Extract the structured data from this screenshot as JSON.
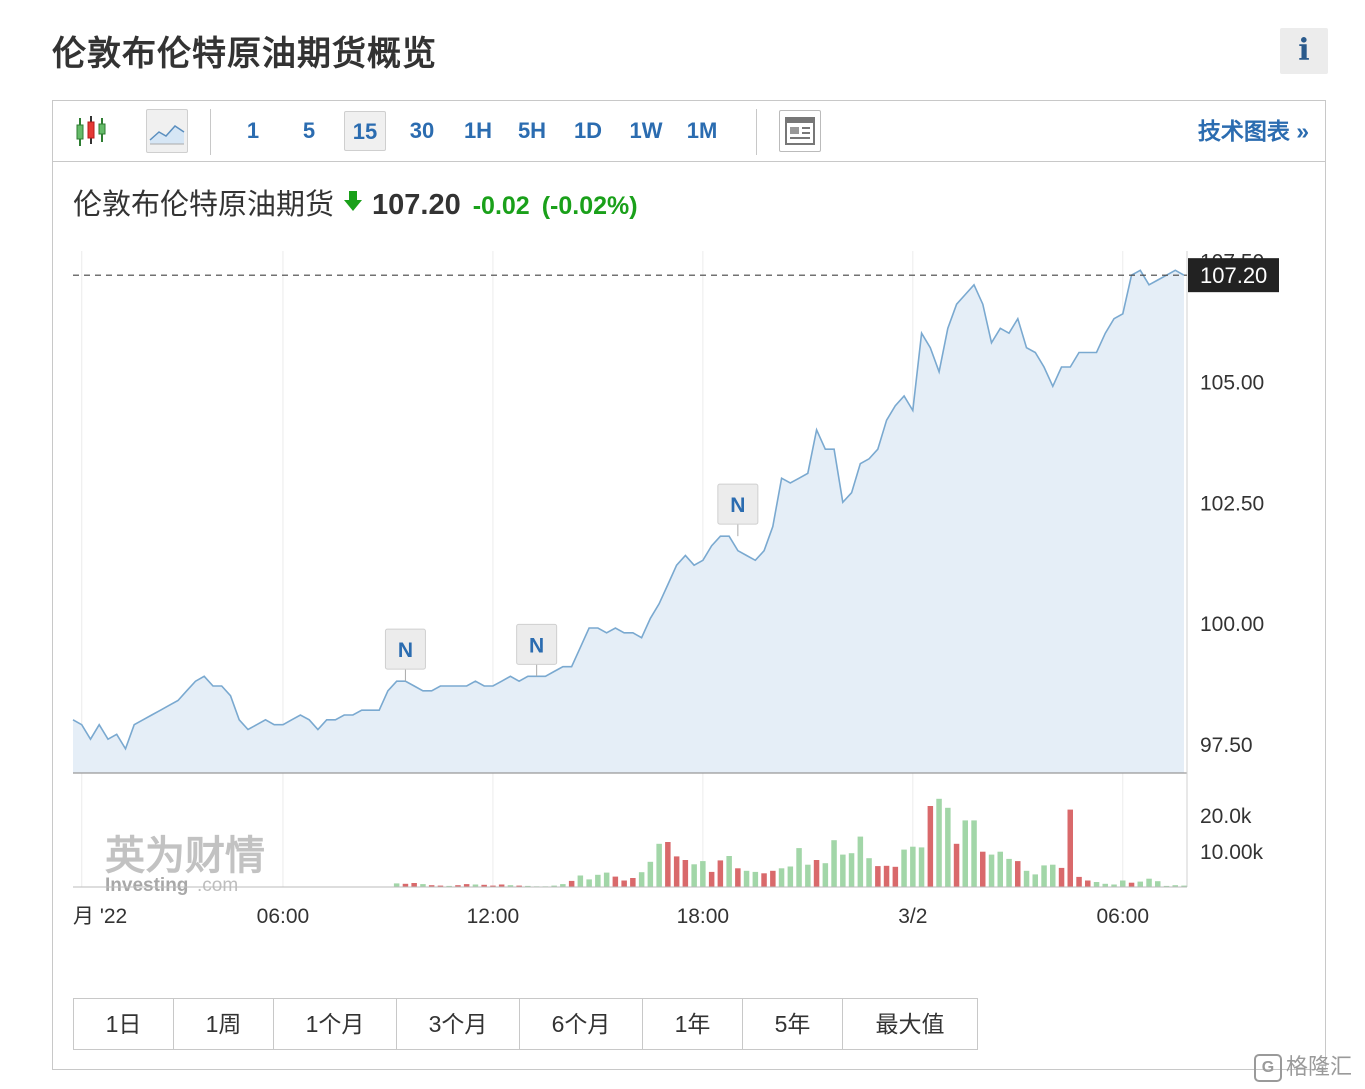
{
  "page": {
    "title": "伦敦布伦特原油期货概览",
    "info_label": "i"
  },
  "toolbar": {
    "intervals": [
      "1",
      "5",
      "15",
      "30",
      "1H",
      "5H",
      "1D",
      "1W",
      "1M"
    ],
    "active_interval": "15",
    "tech_chart_label": "技术图表 »"
  },
  "quote": {
    "name": "伦敦布伦特原油期货",
    "direction": "down",
    "price": "107.20",
    "change": "-0.02",
    "change_pct": "(-0.02%)",
    "change_color": "#1aa01a"
  },
  "watermark": {
    "cn": "英为财情",
    "en": "Investing",
    "suffix": ".com"
  },
  "range_buttons": [
    "1日",
    "1周",
    "1个月",
    "3个月",
    "6个月",
    "1年",
    "5年",
    "最大值"
  ],
  "corner_logo": {
    "text": "格隆汇"
  },
  "colors": {
    "line": "#7aa9d0",
    "area": "#e5eef7",
    "vol_up": "#a2d6a8",
    "vol_down": "#d9696b",
    "accent": "#2b6cb0",
    "price_tag_bg": "#222222"
  },
  "chart_data": [
    {
      "type": "area",
      "title": "",
      "ylabel": "",
      "ylim": [
        96.9,
        107.7
      ],
      "y_tick_labels": [
        "107.50",
        "105.00",
        "102.50",
        "100.00",
        "97.50"
      ],
      "x_tick_labels": [
        {
          "label": "月 '22",
          "t": 1
        },
        {
          "label": "06:00",
          "t": 24
        },
        {
          "label": "12:00",
          "t": 48
        },
        {
          "label": "18:00",
          "t": 72
        },
        {
          "label": "3/2",
          "t": 96
        },
        {
          "label": "06:00",
          "t": 120
        }
      ],
      "current_price": {
        "value": 107.2,
        "label": "107.20"
      },
      "series": [
        {
          "values": [
            98.0,
            97.9,
            97.6,
            97.9,
            97.6,
            97.7,
            97.4,
            97.9,
            98.0,
            98.1,
            98.2,
            98.3,
            98.4,
            98.6,
            98.8,
            98.9,
            98.7,
            98.7,
            98.5,
            98.0,
            97.8,
            97.9,
            98.0,
            97.9,
            97.9,
            98.0,
            98.1,
            98.0,
            97.8,
            98.0,
            98.0,
            98.1,
            98.1,
            98.2,
            98.2,
            98.2,
            98.6,
            98.8,
            98.8,
            98.7,
            98.6,
            98.6,
            98.7,
            98.7,
            98.7,
            98.7,
            98.8,
            98.7,
            98.7,
            98.8,
            98.9,
            98.8,
            98.9,
            98.9,
            98.9,
            99.0,
            99.1,
            99.1,
            99.5,
            99.9,
            99.9,
            99.8,
            99.9,
            99.8,
            99.8,
            99.7,
            100.1,
            100.4,
            100.8,
            101.2,
            101.4,
            101.2,
            101.3,
            101.6,
            101.8,
            101.8,
            101.5,
            101.4,
            101.3,
            101.5,
            102.0,
            103.0,
            102.9,
            103.0,
            103.1,
            104.0,
            103.6,
            103.6,
            102.5,
            102.7,
            103.3,
            103.4,
            103.6,
            104.2,
            104.5,
            104.7,
            104.4,
            106.0,
            105.7,
            105.2,
            106.1,
            106.6,
            106.8,
            107.0,
            106.6,
            105.8,
            106.1,
            106.0,
            106.3,
            105.7,
            105.6,
            105.3,
            104.9,
            105.3,
            105.3,
            105.6,
            105.6,
            105.6,
            106.0,
            106.3,
            106.4,
            107.2,
            107.3,
            107.0,
            107.1,
            107.2,
            107.3,
            107.2
          ]
        }
      ],
      "news_markers": [
        {
          "t": 38,
          "value": 98.8,
          "label": "N"
        },
        {
          "t": 53,
          "value": 98.9,
          "label": "N"
        },
        {
          "t": 76,
          "value": 101.8,
          "label": "N"
        }
      ]
    },
    {
      "type": "bar",
      "title": "",
      "ylim": [
        0,
        25000
      ],
      "y_tick_labels": [
        "20.0k",
        "10.00k"
      ],
      "series": [
        {
          "values": [
            0,
            0,
            0,
            0,
            0,
            0,
            0,
            0,
            0,
            0,
            0,
            0,
            0,
            0,
            0,
            0,
            0,
            0,
            0,
            0,
            0,
            0,
            0,
            0,
            0,
            0,
            0,
            0,
            0,
            0,
            0,
            0,
            0,
            0,
            0,
            0,
            0,
            1000,
            900,
            1100,
            800,
            500,
            400,
            300,
            500,
            800,
            700,
            600,
            400,
            700,
            500,
            400,
            300,
            200,
            200,
            400,
            800,
            1700,
            3200,
            2100,
            3400,
            4000,
            2900,
            1800,
            2500,
            4100,
            7000,
            12000,
            12500,
            8500,
            7500,
            6300,
            7200,
            4200,
            7400,
            8600,
            5200,
            4500,
            4200,
            3800,
            4500,
            5200,
            5700,
            10800,
            6200,
            7500,
            6600,
            13000,
            9000,
            9400,
            14000,
            8000,
            5800,
            5900,
            5600,
            10400,
            11200,
            11000,
            22500,
            24500,
            22000,
            12000,
            18500,
            18500,
            9800,
            9000,
            9800,
            7800,
            7200,
            4500,
            3500,
            6000,
            6200,
            5300,
            21500,
            2800,
            1800,
            1400,
            900,
            700,
            1800,
            1200,
            1500,
            2300,
            1600,
            300,
            500,
            400
          ],
          "directions": "dddddddddddddddddddddddddddddddddddddudduddudduddduduuuuuduuuuddduuuddduudduduudduuuuduuuuuuddduuuduuduuduuuduuuudddduuuuduuuuuuudu"
        }
      ]
    }
  ]
}
